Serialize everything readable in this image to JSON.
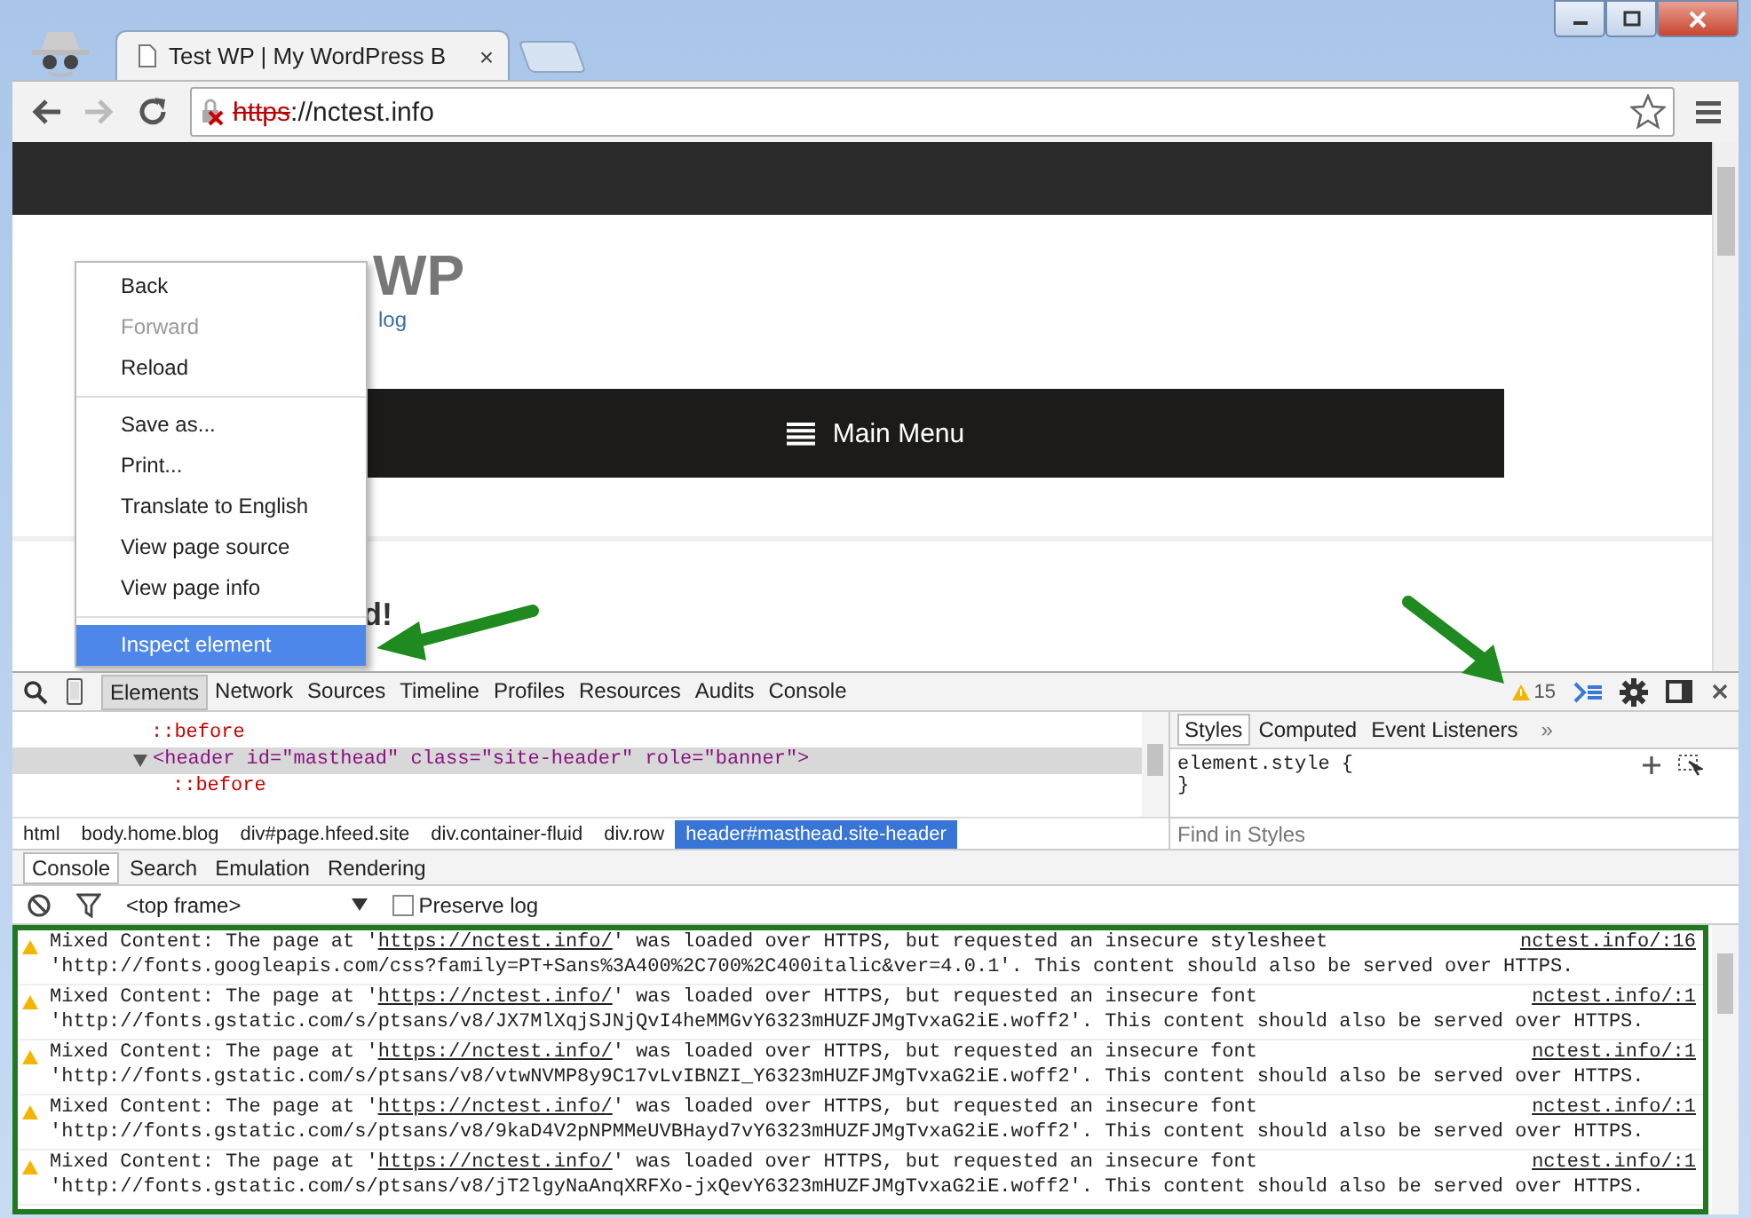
{
  "tab": {
    "title": "Test WP | My WordPress B",
    "close": "×"
  },
  "address_bar": {
    "scheme": "https",
    "rest": "://nctest.info"
  },
  "page": {
    "title_visible": "WP",
    "tagline_visible": "log",
    "nav_label": "Main Menu",
    "post_title_visible": "d!"
  },
  "context_menu": {
    "groups": [
      [
        {
          "label": "Back",
          "disabled": false,
          "selected": false
        },
        {
          "label": "Forward",
          "disabled": true,
          "selected": false
        },
        {
          "label": "Reload",
          "disabled": false,
          "selected": false
        }
      ],
      [
        {
          "label": "Save as...",
          "disabled": false,
          "selected": false
        },
        {
          "label": "Print...",
          "disabled": false,
          "selected": false
        },
        {
          "label": "Translate to English",
          "disabled": false,
          "selected": false
        },
        {
          "label": "View page source",
          "disabled": false,
          "selected": false
        },
        {
          "label": "View page info",
          "disabled": false,
          "selected": false
        }
      ],
      [
        {
          "label": "Inspect element",
          "disabled": false,
          "selected": true
        }
      ]
    ]
  },
  "devtools": {
    "tabs": [
      {
        "label": "Elements",
        "selected": true
      },
      {
        "label": "Network",
        "selected": false
      },
      {
        "label": "Sources",
        "selected": false
      },
      {
        "label": "Timeline",
        "selected": false
      },
      {
        "label": "Profiles",
        "selected": false
      },
      {
        "label": "Resources",
        "selected": false
      },
      {
        "label": "Audits",
        "selected": false
      },
      {
        "label": "Console",
        "selected": false
      }
    ],
    "warning_count": "15",
    "dom_lines": [
      {
        "text": "::before",
        "kind": "pseudo",
        "selected": false,
        "expanded": false
      },
      {
        "text": "<header id=\"masthead\" class=\"site-header\" role=\"banner\">",
        "kind": "tag",
        "selected": true,
        "expanded": true
      },
      {
        "text": "::before",
        "kind": "pseudo2",
        "selected": false,
        "expanded": false
      }
    ],
    "breadcrumbs": [
      {
        "label": "html",
        "selected": false
      },
      {
        "label": "body.home.blog",
        "selected": false
      },
      {
        "label": "div#page.hfeed.site",
        "selected": false
      },
      {
        "label": "div.container-fluid",
        "selected": false
      },
      {
        "label": "div.row",
        "selected": false
      },
      {
        "label": "header#masthead.site-header",
        "selected": true
      }
    ],
    "styles_tabs": [
      {
        "label": "Styles",
        "selected": true
      },
      {
        "label": "Computed",
        "selected": false
      },
      {
        "label": "Event Listeners",
        "selected": false
      }
    ],
    "styles_more": "»",
    "style_rule_open": "element.style {",
    "style_rule_close": "}",
    "styles_filter_placeholder": "Find in Styles",
    "drawer_tabs": [
      {
        "label": "Console",
        "selected": true
      },
      {
        "label": "Search",
        "selected": false
      },
      {
        "label": "Emulation",
        "selected": false
      },
      {
        "label": "Rendering",
        "selected": false
      }
    ],
    "frame_select": "<top frame>",
    "preserve_log": {
      "label": "Preserve log",
      "checked": false
    },
    "messages": [
      {
        "before": "Mixed Content: The page at '",
        "link": "https://nctest.info/",
        "after": "' was loaded over HTTPS, but requested an insecure stylesheet",
        "line_2": "'http://fonts.googleapis.com/css?family=PT+Sans%3A400%2C700%2C400italic&ver=4.0.1'. This content should also be served over HTTPS.",
        "source": "nctest.info/:16"
      },
      {
        "before": "Mixed Content: The page at '",
        "link": "https://nctest.info/",
        "after": "' was loaded over HTTPS, but requested an insecure font",
        "line_2": "'http://fonts.gstatic.com/s/ptsans/v8/JX7MlXqjSJNjQvI4heMMGvY6323mHUZFJMgTvxaG2iE.woff2'. This content should also be served over HTTPS.",
        "source": "nctest.info/:1"
      },
      {
        "before": "Mixed Content: The page at '",
        "link": "https://nctest.info/",
        "after": "' was loaded over HTTPS, but requested an insecure font",
        "line_2": "'http://fonts.gstatic.com/s/ptsans/v8/vtwNVMP8y9C17vLvIBNZI_Y6323mHUZFJMgTvxaG2iE.woff2'. This content should also be served over HTTPS.",
        "source": "nctest.info/:1"
      },
      {
        "before": "Mixed Content: The page at '",
        "link": "https://nctest.info/",
        "after": "' was loaded over HTTPS, but requested an insecure font",
        "line_2": "'http://fonts.gstatic.com/s/ptsans/v8/9kaD4V2pNPMMeUVBHayd7vY6323mHUZFJMgTvxaG2iE.woff2'. This content should also be served over HTTPS.",
        "source": "nctest.info/:1"
      },
      {
        "before": "Mixed Content: The page at '",
        "link": "https://nctest.info/",
        "after": "' was loaded over HTTPS, but requested an insecure font",
        "line_2": "'http://fonts.gstatic.com/s/ptsans/v8/jT2lgyNaAnqXRFXo-jxQevY6323mHUZFJMgTvxaG2iE.woff2'. This content should also be served over HTTPS.",
        "source": "nctest.info/:1"
      }
    ]
  }
}
